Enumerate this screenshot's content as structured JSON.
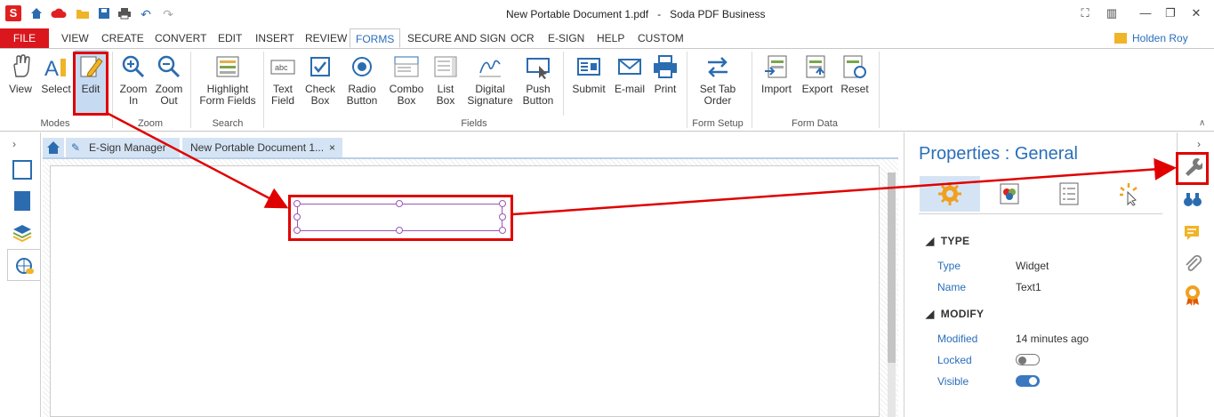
{
  "title_bar": {
    "logo": "S",
    "document": "New Portable Document 1.pdf",
    "separator": "-",
    "app": "Soda PDF Business"
  },
  "quick_access": [
    "home-icon",
    "cloud-icon",
    "folder-icon",
    "save-icon",
    "print-icon",
    "undo-icon",
    "redo-icon"
  ],
  "menu": [
    "FILE",
    "VIEW",
    "CREATE",
    "CONVERT",
    "EDIT",
    "INSERT",
    "REVIEW",
    "FORMS",
    "SECURE AND SIGN",
    "OCR",
    "E-SIGN",
    "HELP",
    "CUSTOM"
  ],
  "active_menu": "FORMS",
  "user": "Holden Roy",
  "ribbon": {
    "modes": {
      "label": "Modes",
      "view": "View",
      "select": "Select",
      "edit": "Edit"
    },
    "zoom": {
      "label": "Zoom",
      "zoom_in_1": "Zoom",
      "zoom_in_2": "In",
      "zoom_out_1": "Zoom",
      "zoom_out_2": "Out"
    },
    "search": {
      "label": "Search",
      "highlight_1": "Highlight",
      "highlight_2": "Form Fields"
    },
    "fields": {
      "label": "Fields",
      "text_1": "Text",
      "text_2": "Field",
      "check_1": "Check",
      "check_2": "Box",
      "radio_1": "Radio",
      "radio_2": "Button",
      "combo_1": "Combo",
      "combo_2": "Box",
      "list_1": "List",
      "list_2": "Box",
      "digital_1": "Digital",
      "digital_2": "Signature",
      "push_1": "Push",
      "push_2": "Button",
      "submit": "Submit",
      "email": "E-mail",
      "print": "Print"
    },
    "form_setup": {
      "label": "Form Setup",
      "set_tab_1": "Set Tab",
      "set_tab_2": "Order"
    },
    "form_data": {
      "label": "Form Data",
      "import": "Import",
      "export": "Export",
      "reset": "Reset"
    }
  },
  "tabs": {
    "esign": "E-Sign Manager",
    "document": "New Portable Document 1...",
    "close": "×"
  },
  "properties": {
    "title": "Properties : General",
    "type_section": "TYPE",
    "type_label": "Type",
    "type_value": "Widget",
    "name_label": "Name",
    "name_value": "Text1",
    "modify_section": "MODIFY",
    "modified_label": "Modified",
    "modified_value": "14 minutes ago",
    "locked_label": "Locked",
    "locked": false,
    "visible_label": "Visible",
    "visible": true
  },
  "colors": {
    "accent": "#2a6ebb",
    "file_tab": "#d9171d",
    "annotation": "#e00000",
    "field_border": "#9b59b6"
  }
}
